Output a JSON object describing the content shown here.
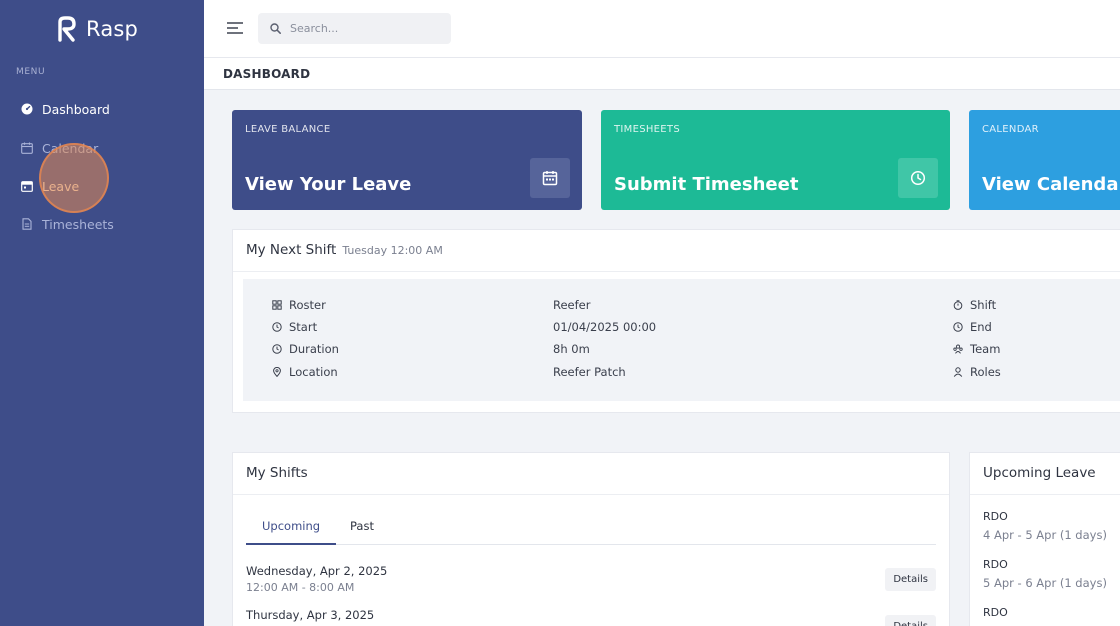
{
  "app": {
    "name": "Rasp"
  },
  "sidebar": {
    "menu_heading": "MENU",
    "items": [
      {
        "label": "Dashboard",
        "icon": "dashboard-icon",
        "active": true
      },
      {
        "label": "Calendar",
        "icon": "calendar-icon",
        "active": false
      },
      {
        "label": "Leave",
        "icon": "leave-icon",
        "active": false
      },
      {
        "label": "Timesheets",
        "icon": "timesheet-icon",
        "active": false
      }
    ]
  },
  "topbar": {
    "search_placeholder": "Search..."
  },
  "page": {
    "title": "DASHBOARD"
  },
  "cards": [
    {
      "label": "LEAVE BALANCE",
      "title": "View Your Leave",
      "icon": "calendar-icon",
      "color": "#3e4d89"
    },
    {
      "label": "TIMESHEETS",
      "title": "Submit Timesheet",
      "icon": "clock-icon",
      "color": "#1dba96"
    },
    {
      "label": "CALENDAR",
      "title": "View Calendar",
      "icon": "calendar-icon",
      "color": "#2d9fe0"
    }
  ],
  "next_shift": {
    "title": "My Next Shift",
    "subtitle": "Tuesday 12:00 AM",
    "rows": [
      {
        "label": "Roster",
        "icon": "roster-icon",
        "value": "Reefer"
      },
      {
        "label": "Start",
        "icon": "clock-icon",
        "value": "01/04/2025 00:00"
      },
      {
        "label": "Duration",
        "icon": "clock-icon",
        "value": "8h 0m"
      },
      {
        "label": "Location",
        "icon": "location-icon",
        "value": "Reefer Patch"
      }
    ],
    "right_rows": [
      {
        "label": "Shift",
        "icon": "timer-icon"
      },
      {
        "label": "End",
        "icon": "clock-icon"
      },
      {
        "label": "Team",
        "icon": "team-icon"
      },
      {
        "label": "Roles",
        "icon": "user-icon"
      }
    ]
  },
  "my_shifts": {
    "title": "My Shifts",
    "tabs": [
      "Upcoming",
      "Past"
    ],
    "items": [
      {
        "date": "Wednesday, Apr 2, 2025",
        "time": "12:00 AM - 8:00 AM",
        "button": "Details"
      },
      {
        "date": "Thursday, Apr 3, 2025",
        "time": "",
        "button": "Details"
      }
    ]
  },
  "upcoming_leave": {
    "title": "Upcoming Leave",
    "items": [
      {
        "type": "RDO",
        "range": "4 Apr - 5 Apr (1 days)"
      },
      {
        "type": "RDO",
        "range": "5 Apr - 6 Apr (1 days)"
      },
      {
        "type": "RDO",
        "range": ""
      }
    ]
  },
  "colors": {
    "sidebar": "#3e4d89",
    "accent": "#3e4d89",
    "teal": "#1dba96",
    "blue": "#2d9fe0"
  }
}
